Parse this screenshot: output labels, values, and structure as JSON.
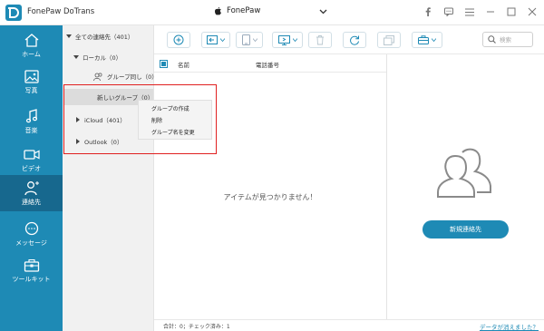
{
  "app": {
    "title": "FonePaw DoTrans",
    "device_name": "FonePaw"
  },
  "window_controls": [
    "facebook-icon",
    "feedback-icon",
    "menu-icon",
    "minimize-icon",
    "maximize-icon",
    "close-icon"
  ],
  "sidebar": {
    "items": [
      {
        "label": "ホーム",
        "icon": "home-icon"
      },
      {
        "label": "写真",
        "icon": "photo-icon"
      },
      {
        "label": "音楽",
        "icon": "music-icon"
      },
      {
        "label": "ビデオ",
        "icon": "video-icon"
      },
      {
        "label": "連絡先",
        "icon": "contacts-icon",
        "active": true
      },
      {
        "label": "メッセージ",
        "icon": "message-icon"
      },
      {
        "label": "ツールキット",
        "icon": "toolkit-icon"
      }
    ],
    "active_color": "#17688e",
    "bg_color": "#1e8ab5"
  },
  "tree": {
    "all": "全ての連絡先（401）",
    "local": "ローカル（0）",
    "group1": "グループ同し（0）",
    "group2": "新しいグループ（0）",
    "icloud": "iCloud（401）",
    "outlook": "Outlook（0）"
  },
  "context_menu": {
    "items": [
      "グループの作成",
      "削除",
      "グループ名を変更"
    ]
  },
  "toolbar": {
    "buttons": [
      "add-icon",
      "import-icon",
      "export-device-icon",
      "export-pc-icon",
      "delete-icon",
      "refresh-icon",
      "copy-icon",
      "toolbox-icon"
    ],
    "search_placeholder": "検索"
  },
  "list": {
    "col_name": "名前",
    "col_phone": "電話番号",
    "empty": "アイテムが見つかりません！"
  },
  "detail": {
    "new_contact": "新規連絡先"
  },
  "footer": {
    "status": "合計：0；チェック済み：1",
    "link": "データが消えました？"
  },
  "colors": {
    "accent": "#1e8ab5",
    "highlight": "#e02020"
  }
}
